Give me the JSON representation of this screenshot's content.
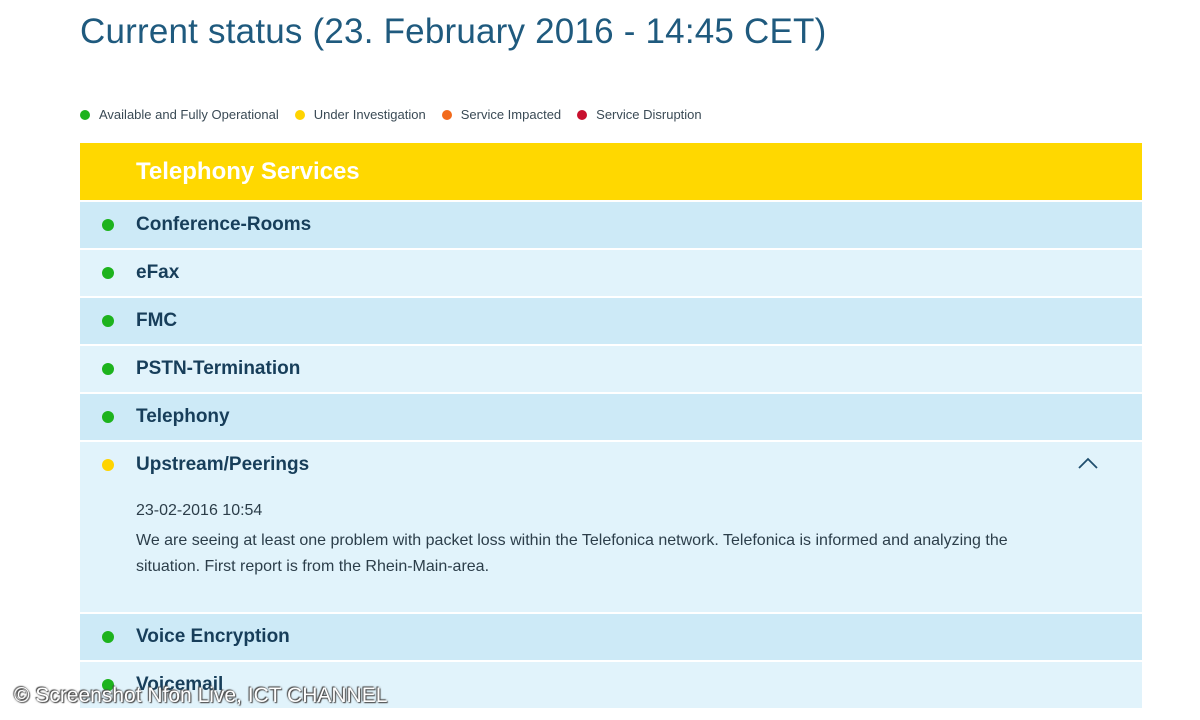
{
  "page": {
    "title": "Current status (23. February 2016 - 14:45 CET)"
  },
  "legend": [
    {
      "label": "Available and Fully Operational",
      "color": "#1db31d"
    },
    {
      "label": "Under Investigation",
      "color": "#ffd400"
    },
    {
      "label": "Service Impacted",
      "color": "#f26a1b"
    },
    {
      "label": "Service Disruption",
      "color": "#c8102e"
    }
  ],
  "panel": {
    "title": "Telephony Services",
    "services": [
      {
        "name": "Conference-Rooms",
        "status": "available"
      },
      {
        "name": "eFax",
        "status": "available"
      },
      {
        "name": "FMC",
        "status": "available"
      },
      {
        "name": "PSTN-Termination",
        "status": "available"
      },
      {
        "name": "Telephony",
        "status": "available"
      },
      {
        "name": "Upstream/Peerings",
        "status": "investigation",
        "expanded": true,
        "detail": {
          "timestamp": "23-02-2016 10:54",
          "message": "We are seeing at least one problem with packet loss within the Telefonica network. Telefonica is informed and analyzing the situation. First report is from the Rhein-Main-area."
        }
      },
      {
        "name": "Voice Encryption",
        "status": "available"
      },
      {
        "name": "Voicemail",
        "status": "available"
      }
    ]
  },
  "icons": {
    "collapse": "chevron-up-icon",
    "status": "status-dot-icon"
  },
  "colors": {
    "header": "#ffd800",
    "row_dark": "#cdeaf7",
    "row_light": "#e1f3fb",
    "title": "#1f5a7e"
  },
  "watermark": "© Screenshot Nfon Live, ICT CHANNEL"
}
